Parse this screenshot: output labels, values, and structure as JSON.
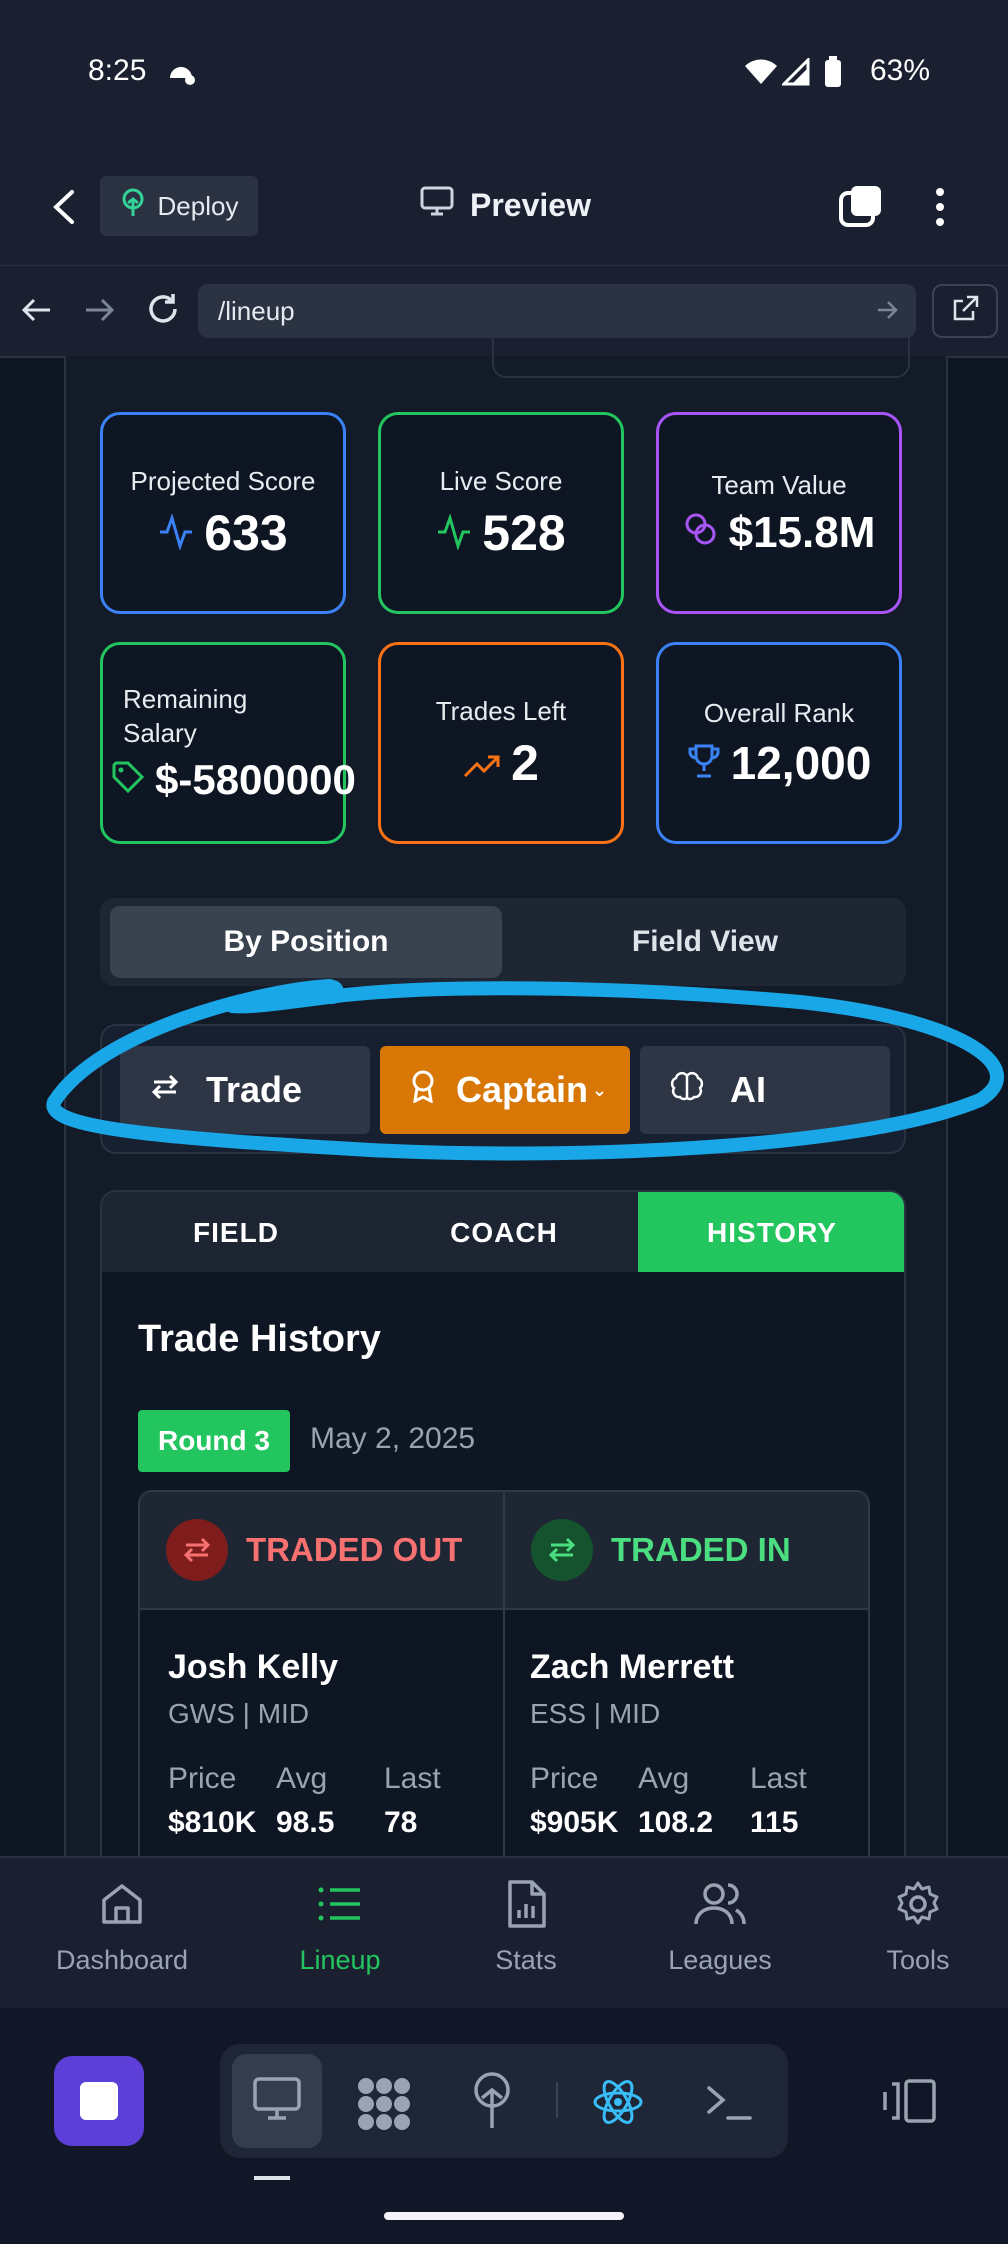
{
  "status_bar": {
    "time": "8:25",
    "battery": "63%"
  },
  "app_bar": {
    "deploy_label": "Deploy",
    "preview_label": "Preview"
  },
  "url_bar": {
    "url": "/lineup"
  },
  "stats": [
    {
      "label": "Projected Score",
      "value": "633",
      "icon": "activity-icon",
      "color": "#3b82f6"
    },
    {
      "label": "Live Score",
      "value": "528",
      "icon": "activity-icon",
      "color": "#22c55e"
    },
    {
      "label": "Team Value",
      "value": "$15.8M",
      "icon": "coins-icon",
      "color": "#a855f7"
    },
    {
      "label": "Remaining Salary",
      "value": "$-5800000",
      "icon": "tag-icon",
      "color": "#22c55e"
    },
    {
      "label": "Trades Left",
      "value": "2",
      "icon": "trending-up-icon",
      "color": "#f97316"
    },
    {
      "label": "Overall Rank",
      "value": "12,000",
      "icon": "trophy-icon",
      "color": "#3b82f6"
    }
  ],
  "view_toggle": {
    "options": [
      "By Position",
      "Field View"
    ],
    "selected": "By Position"
  },
  "actions": {
    "trade": "Trade",
    "captain": "Captain",
    "ai": "AI"
  },
  "tabs": {
    "items": [
      "FIELD",
      "COACH",
      "HISTORY"
    ],
    "active": "HISTORY"
  },
  "history": {
    "title": "Trade History",
    "round": "Round 3",
    "date": "May 2, 2025",
    "out": {
      "header": "TRADED OUT",
      "name": "Josh Kelly",
      "team_pos": "GWS | MID",
      "price_label": "Price",
      "avg_label": "Avg",
      "last_label": "Last",
      "price": "$810K",
      "avg": "98.5",
      "last": "78"
    },
    "in": {
      "header": "TRADED IN",
      "name": "Zach Merrett",
      "team_pos": "ESS | MID",
      "price_label": "Price",
      "avg_label": "Avg",
      "last_label": "Last",
      "price": "$905K",
      "avg": "108.2",
      "last": "115"
    }
  },
  "bottom_nav": {
    "items": [
      "Dashboard",
      "Lineup",
      "Stats",
      "Leagues",
      "Tools"
    ],
    "active": "Lineup"
  },
  "colors": {
    "accent_green": "#22c55e",
    "captain_orange": "#d97706",
    "annotation_blue": "#1aa7e8"
  }
}
